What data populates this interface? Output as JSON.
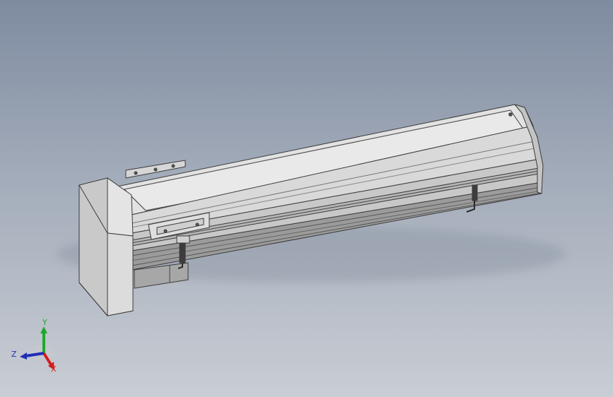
{
  "viewport": {
    "background_top": "#7e8ba0",
    "background_bottom": "#c9cdd4"
  },
  "model": {
    "name": "linear-module-belt-actuator",
    "edge_color": "#3a3a3a",
    "face_light": "#e4e4e4",
    "face_mid": "#cfcfcf",
    "face_dark": "#a9a9a9"
  },
  "triad": {
    "x_label": "X",
    "y_label": "Y",
    "z_label": "Z",
    "x_color": "#d21e1e",
    "y_color": "#1fa82a",
    "z_color": "#1f2fb8"
  }
}
